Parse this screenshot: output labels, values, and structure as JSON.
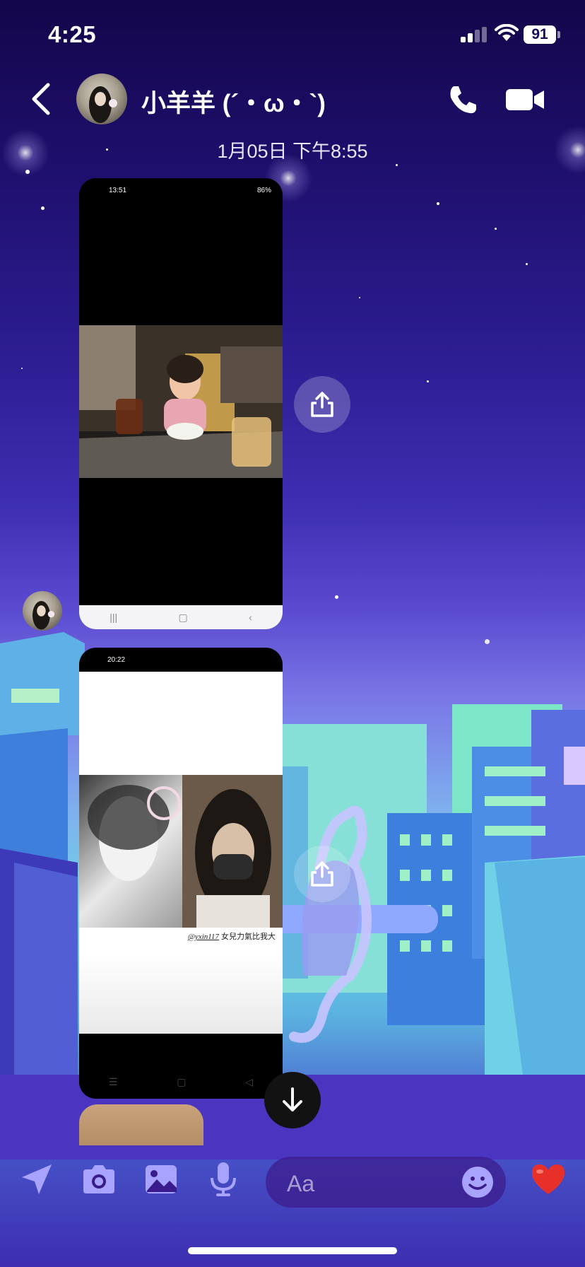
{
  "status_bar": {
    "time": "4:25",
    "battery": "91"
  },
  "header": {
    "contact_name": "小羊羊 (´・ω・`)",
    "back_icon": "chevron-left-icon",
    "call_icon": "phone-icon",
    "video_icon": "video-camera-icon"
  },
  "conversation": {
    "timestamp": "1月05日 下午8:55",
    "messages": [
      {
        "type": "image",
        "status_time": "13:51",
        "status_battery": "86%",
        "nav_icons": [
          "|||",
          "▢",
          "‹"
        ]
      },
      {
        "type": "image",
        "status_time": "20:22",
        "caption": "女兒力氣比我大",
        "caption_handle": "@yxin117",
        "nav_icons": [
          "☰",
          "▢",
          "◁"
        ]
      }
    ]
  },
  "composer": {
    "placeholder": "Aa",
    "icons": [
      "location-arrow-icon",
      "camera-icon",
      "gallery-icon",
      "microphone-icon",
      "emoji-icon",
      "heart-icon"
    ]
  },
  "colors": {
    "accent_heart": "#e8302a",
    "composer_icon": "#a7a3ff"
  }
}
